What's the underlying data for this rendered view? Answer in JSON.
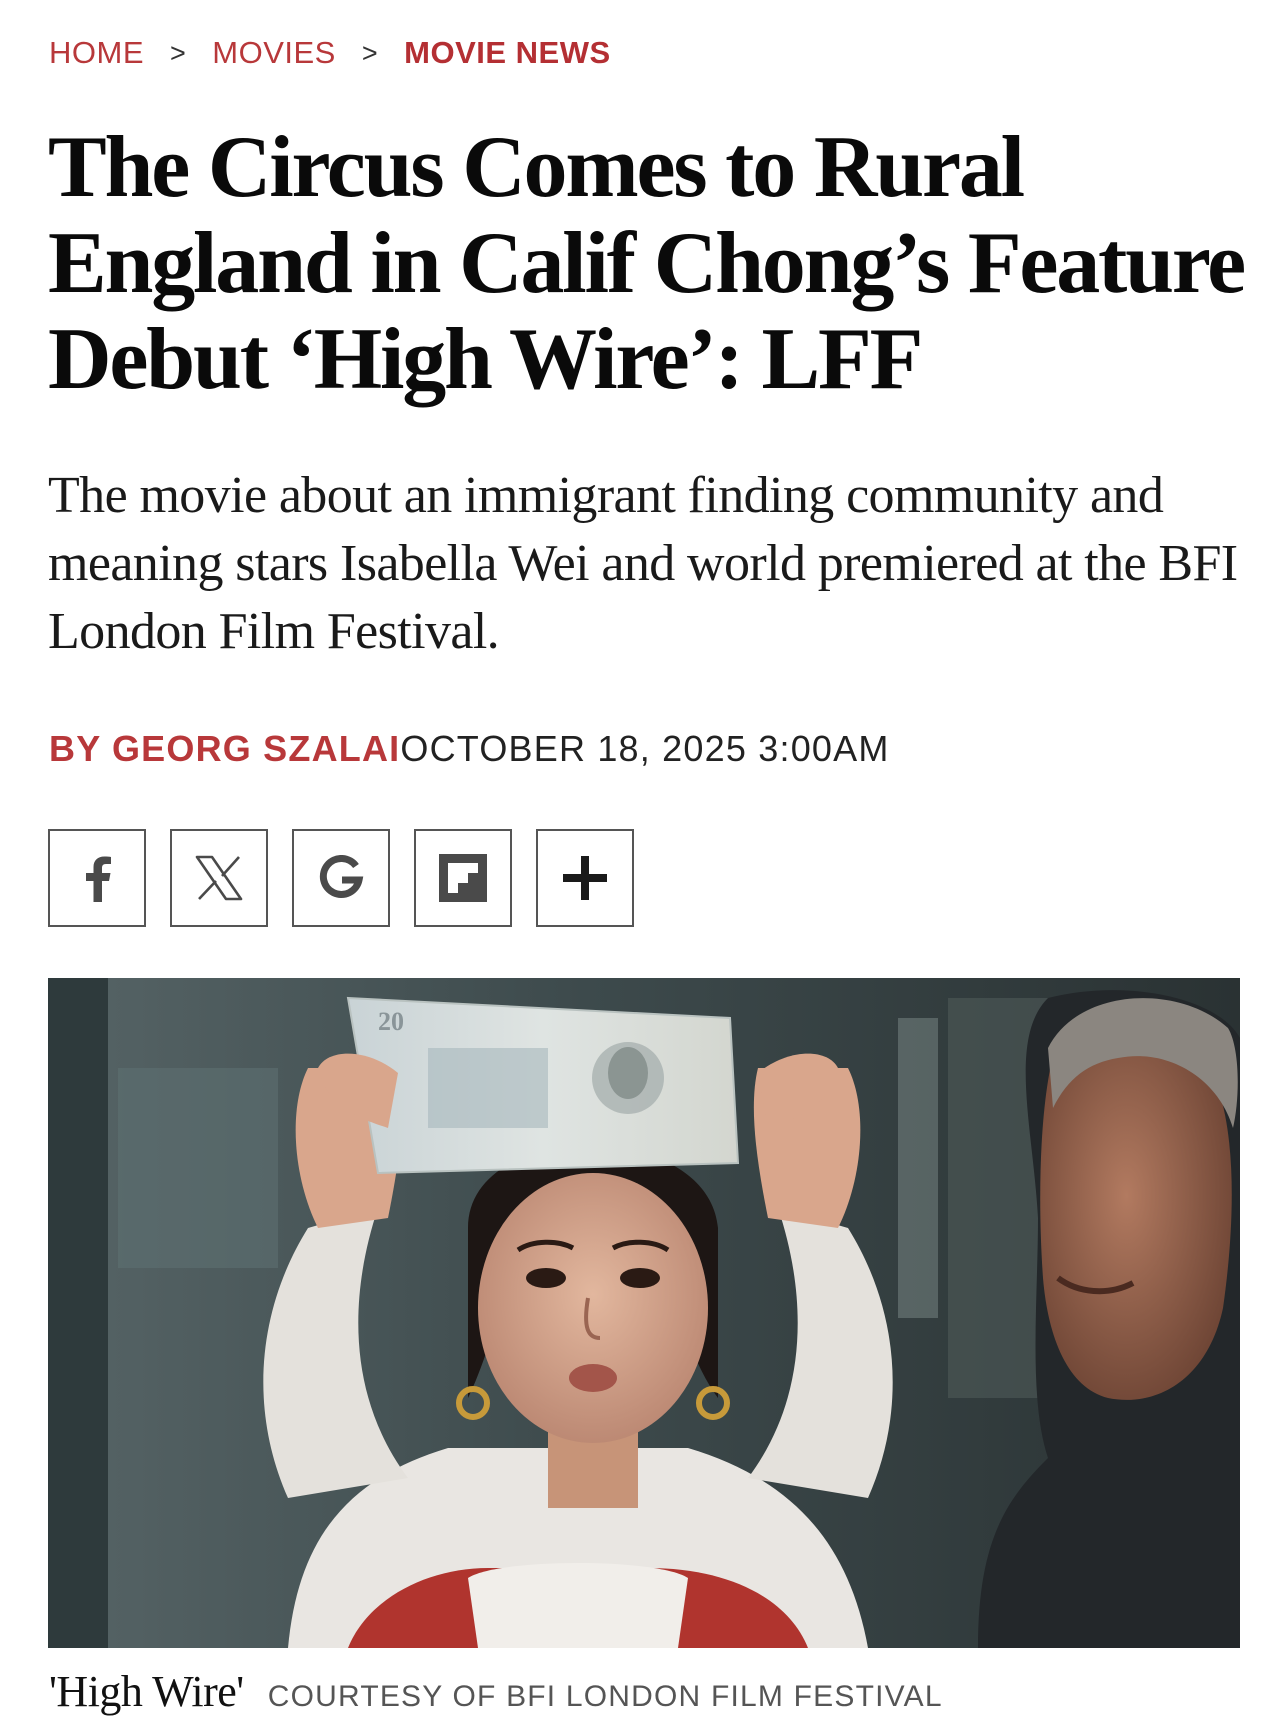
{
  "breadcrumb": {
    "items": [
      {
        "label": "HOME"
      },
      {
        "label": "MOVIES"
      },
      {
        "label": "MOVIE NEWS"
      }
    ],
    "separator": ">"
  },
  "article": {
    "headline": "The Circus Comes to Rural England in Calif Chong’s Feature Debut ‘High Wire’: LFF",
    "dek": "The movie about an immigrant finding community and meaning stars Isabella Wei and world premiered at the BFI London Film Festival.",
    "byline": {
      "author": "BY GEORG SZALAI",
      "date": "OCTOBER 18, 2025 3:00AM"
    }
  },
  "share": {
    "buttons": [
      {
        "icon": "facebook-icon"
      },
      {
        "icon": "x-icon"
      },
      {
        "icon": "google-icon"
      },
      {
        "icon": "flipboard-icon"
      },
      {
        "icon": "plus-icon"
      }
    ]
  },
  "image": {
    "banknote_denomination": "20",
    "caption_title": "'High Wire'",
    "credit": "COURTESY OF BFI LONDON FILM FESTIVAL"
  },
  "colors": {
    "accent": "#b8383a",
    "text": "#111111",
    "border": "#555555"
  }
}
